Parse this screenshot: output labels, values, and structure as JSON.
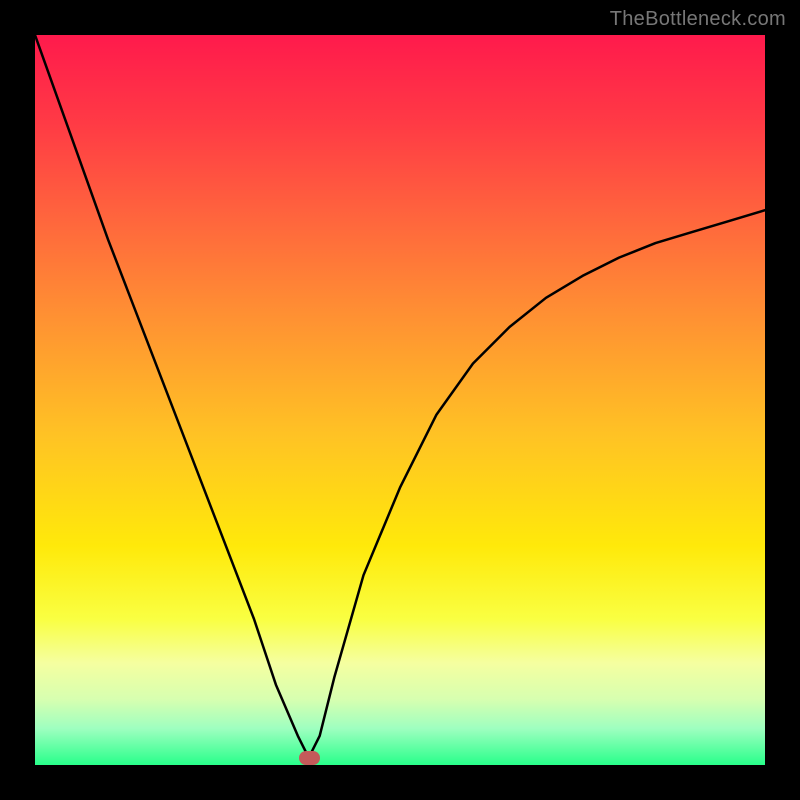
{
  "watermark": "TheBottleneck.com",
  "colors": {
    "frame": "#000000",
    "curve": "#000000",
    "marker": "#c45a5a"
  },
  "chart_data": {
    "type": "line",
    "title": "",
    "xlabel": "",
    "ylabel": "",
    "x": [
      0,
      5,
      10,
      15,
      20,
      25,
      30,
      33,
      36,
      37.5,
      39,
      41,
      45,
      50,
      55,
      60,
      65,
      70,
      75,
      80,
      85,
      90,
      95,
      100
    ],
    "values": [
      100,
      86,
      72,
      59,
      46,
      33,
      20,
      11,
      4,
      1,
      4,
      12,
      26,
      38,
      48,
      55,
      60,
      64,
      67,
      69.5,
      71.5,
      73,
      74.5,
      76
    ],
    "marker": {
      "x": 37.5,
      "y": 1
    },
    "ylim": [
      0,
      100
    ],
    "xlim": [
      0,
      100
    ],
    "grid": false,
    "legend": false
  }
}
